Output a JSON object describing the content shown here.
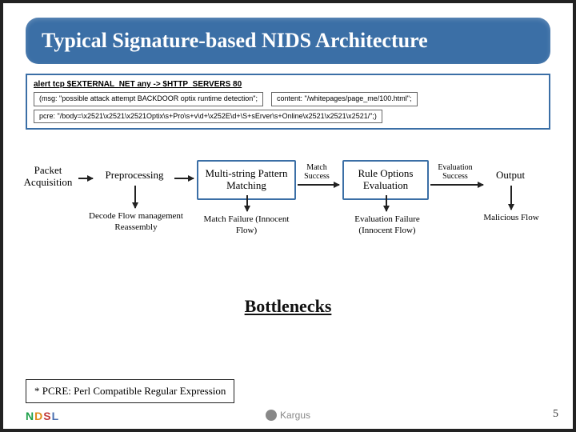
{
  "title": "Typical Signature-based NIDS Architecture",
  "rule": {
    "header": "alert tcp $EXTERNAL_NET any -> $HTTP_SERVERS 80",
    "msg": "(msg: \"possible attack attempt BACKDOOR optix runtime detection\";",
    "content": "content: \"/whitepages/page_me/100.html\";",
    "pcre": "pcre: \"/body=\\x2521\\x2521\\x2521Optix\\s+Pro\\s+v\\d+\\x252E\\d+\\S+sErver\\s+Online\\x2521\\x2521\\x2521/\";)"
  },
  "stages": {
    "s1": "Packet\nAcquisition",
    "s2": "Preprocessing",
    "s3": "Multi-string\nPattern Matching",
    "s4": "Rule Options\nEvaluation",
    "s5": "Output"
  },
  "edges": {
    "e34": "Match\nSuccess",
    "e45": "Evaluation\nSuccess"
  },
  "subs": {
    "sub2": "Decode\nFlow management\nReassembly",
    "sub3": "Match Failure\n(Innocent Flow)",
    "sub4": "Evaluation Failure\n(Innocent Flow)",
    "sub5": "Malicious\nFlow"
  },
  "bottlenecks": "Bottlenecks",
  "footnote": "* PCRE: Perl Compatible Regular Expression",
  "logos": {
    "ndsl": "NDSL",
    "brand": "Kargus"
  },
  "page": "5"
}
